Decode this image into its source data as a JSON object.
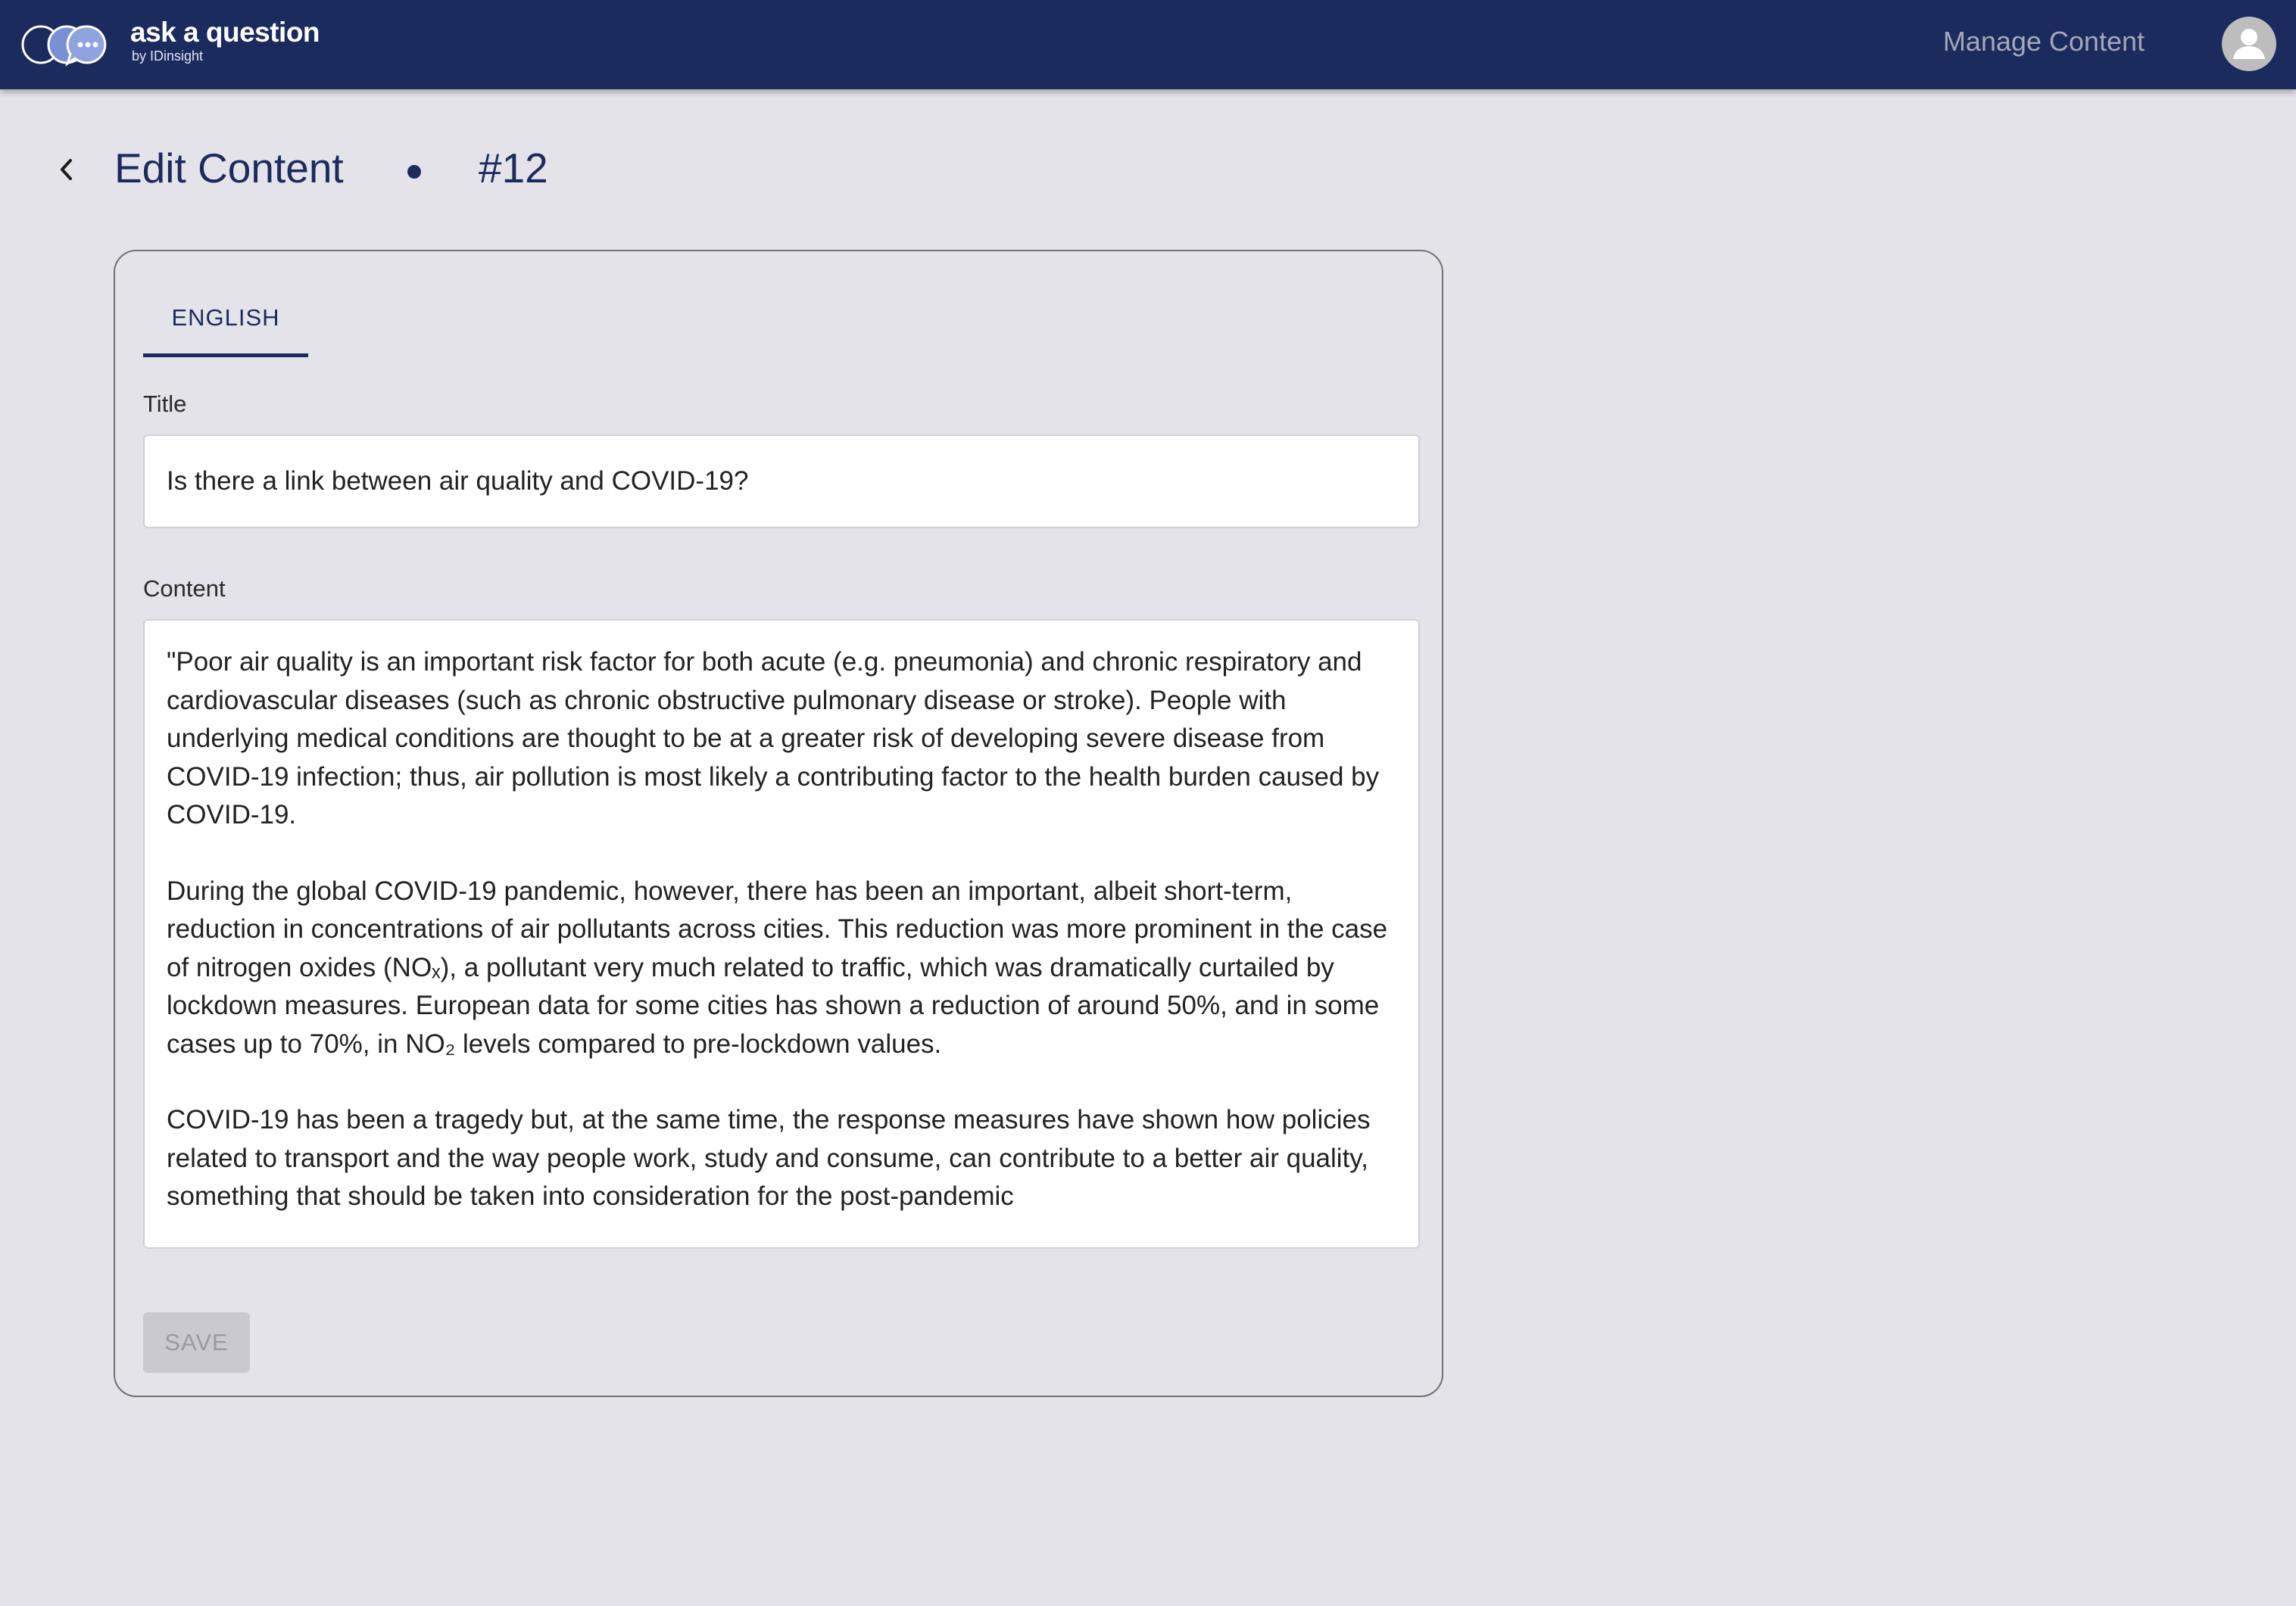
{
  "app": {
    "brand_name": "ask a question",
    "brand_sub": "by IDinsight",
    "nav_link": "Manage Content"
  },
  "header": {
    "title": "Edit Content",
    "content_id": "#12"
  },
  "form": {
    "tab_label": "ENGLISH",
    "title_label": "Title",
    "title_value": "Is there a link between air quality and COVID-19?",
    "content_label": "Content",
    "content_paragraphs": [
      "\"Poor air quality is an important risk factor for both acute (e.g. pneumonia) and chronic respiratory and cardiovascular diseases (such as chronic obstructive pulmonary disease or stroke). People with underlying medical conditions are thought to be at a greater risk of developing severe disease from COVID-19 infection; thus, air pollution is most likely a contributing factor to the health burden caused by COVID-19.",
      "During the global COVID-19 pandemic, however, there has been an important, albeit short-term, reduction in concentrations of air pollutants across cities. This reduction was more prominent in the case of nitrogen oxides (NOₓ), a pollutant very much related to traffic, which was dramatically curtailed by lockdown measures. European data for some cities has shown a reduction of around 50%, and in some cases up to 70%, in NO₂ levels compared to pre-lockdown values.",
      "COVID-19 has been a tragedy but, at the same time, the response measures have shown how policies related to transport and the way people work, study and consume, can contribute to a better air quality, something that should be taken into consideration for the post-pandemic"
    ],
    "save_label": "SAVE",
    "save_disabled": true
  },
  "colors": {
    "navbar": "#1c2b5e",
    "background": "#e4e3e9",
    "accent": "#1c2b5e",
    "disabled_button": "#c9c9cf"
  },
  "icons": {
    "logo": "chat-bubbles-logo",
    "avatar": "person-icon",
    "back": "chevron-left-icon"
  }
}
